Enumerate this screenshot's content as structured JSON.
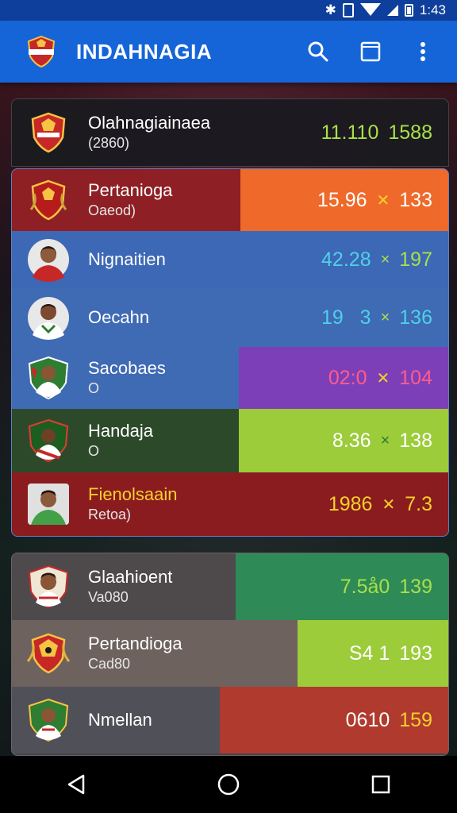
{
  "status_bar": {
    "time": "1:43"
  },
  "app_bar": {
    "title": "INDAHNAGIA"
  },
  "colors": {
    "app_bar": "#1565d8",
    "status_bar": "#0f3f9c",
    "green_text": "#a8e04a",
    "cyan_text": "#4fd0e8",
    "yellow_text": "#f6d12a"
  },
  "header_row": {
    "name": "Olahnagiainaea",
    "sub": "(2860)",
    "stat1": "11.110",
    "stat2": "1588"
  },
  "group1": [
    {
      "name": "Pertanioga",
      "sub": "Oaeod)",
      "stat1": "15.96",
      "sep": "✕",
      "stat2": "133",
      "crest": "red-crest"
    },
    {
      "name": "Nignaitien",
      "sub": "",
      "stat1": "42.28",
      "sep": "×",
      "stat2": "197",
      "crest": "player-photo"
    },
    {
      "name": "Oecahn",
      "sub": "",
      "stat1": "19   3",
      "sep": "×",
      "stat2": "136",
      "crest": "player-photo"
    },
    {
      "name": "Sacobaes",
      "sub": "O",
      "stat1": "02:0",
      "sep": "✕",
      "stat2": "104",
      "crest": "player-photo"
    },
    {
      "name": "Handaja",
      "sub": "O",
      "stat1": "8.36",
      "sep": "×",
      "stat2": "138",
      "crest": "player-photo"
    },
    {
      "name": "Fienolsaain",
      "sub": "Retoa)",
      "stat1": "1986",
      "sep": "✕",
      "stat2": "7.3",
      "crest": "player-photo"
    }
  ],
  "group2": [
    {
      "name": "Glaahioent",
      "sub": "Va080",
      "stat1": "7.5å0",
      "stat2": "139",
      "crest": "player-photo"
    },
    {
      "name": "Pertandioga",
      "sub": "Cad80",
      "stat1": "S4 1",
      "stat2": "193",
      "crest": "gold-crest"
    },
    {
      "name": "Nmellan",
      "sub": "",
      "stat1": "0610",
      "stat2": "159",
      "crest": "player-photo"
    }
  ]
}
